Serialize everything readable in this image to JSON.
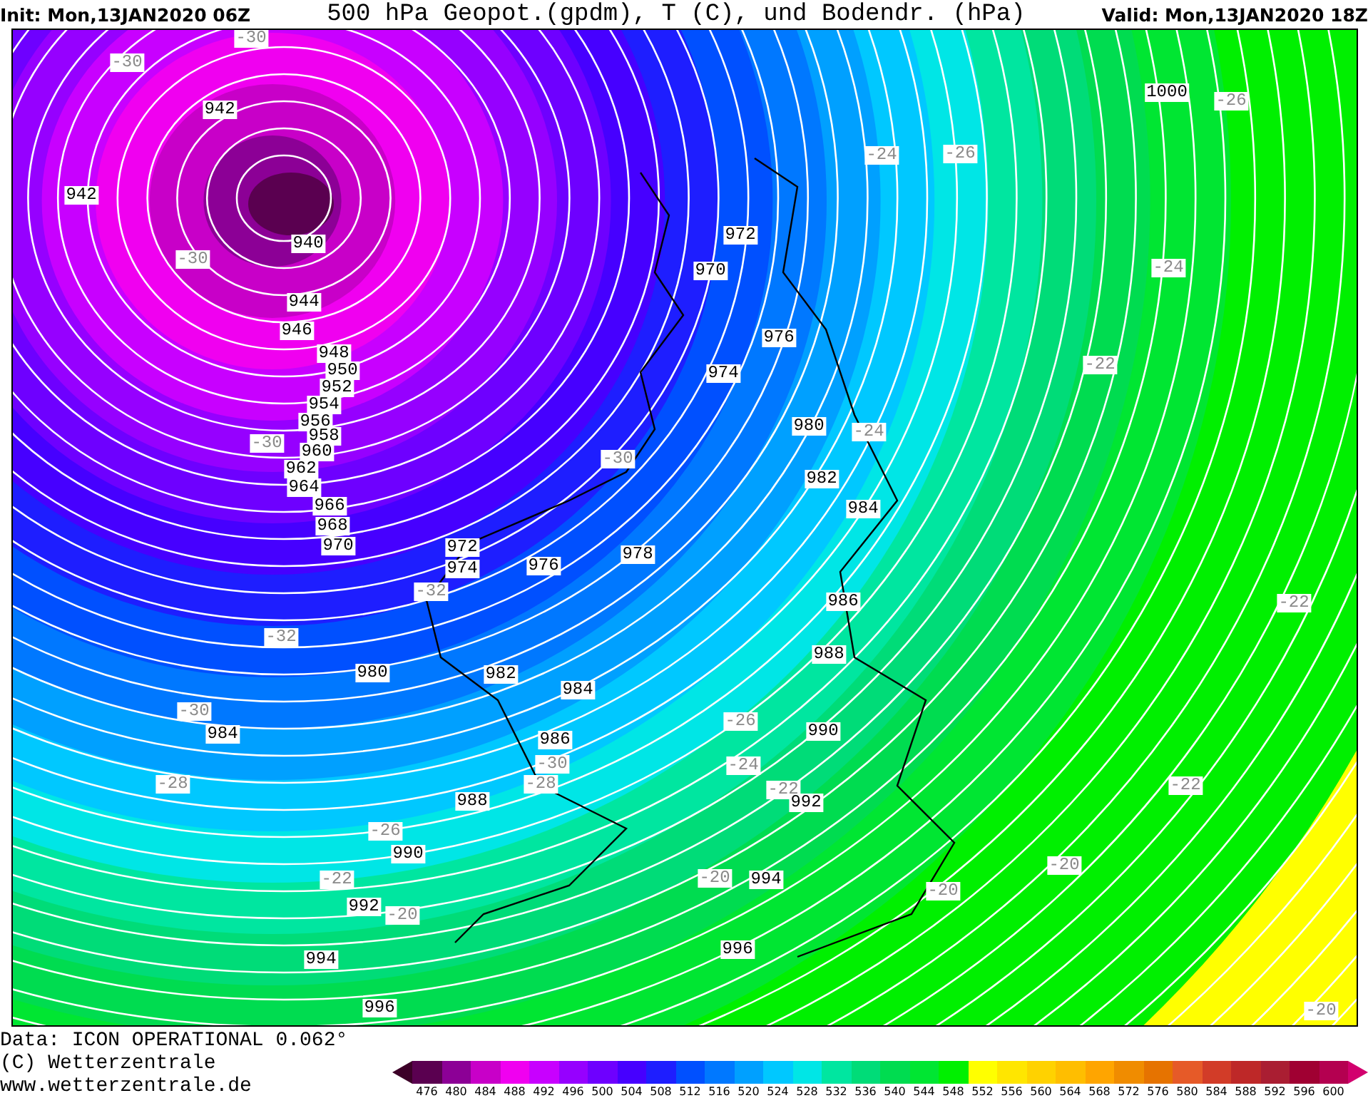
{
  "header": {
    "init": "Init: Mon,13JAN2020 06Z",
    "title": "500 hPa Geopot.(gpdm), T (C), und Bodendr. (hPa)",
    "valid": "Valid: Mon,13JAN2020 18Z"
  },
  "map": {
    "pressure_labels": [
      "942",
      "942",
      "940",
      "944",
      "946",
      "948",
      "950",
      "952",
      "954",
      "956",
      "958",
      "960",
      "962",
      "964",
      "966",
      "968",
      "970",
      "972",
      "974",
      "976",
      "978",
      "972",
      "970",
      "976",
      "974",
      "980",
      "982",
      "984",
      "986",
      "988",
      "980",
      "982",
      "984",
      "986",
      "990",
      "984",
      "988",
      "992",
      "990",
      "994",
      "992",
      "996",
      "994",
      "996",
      "1000"
    ],
    "temperature_labels": [
      "-30",
      "-30",
      "-26",
      "-24",
      "-26",
      "-30",
      "-24",
      "-22",
      "-24",
      "-30",
      "-30",
      "-32",
      "-32",
      "-22",
      "-30",
      "-26",
      "-24",
      "-30",
      "-28",
      "-28",
      "-22",
      "-22",
      "-26",
      "-22",
      "-20",
      "-20",
      "-20",
      "-20",
      "-20"
    ]
  },
  "footer": {
    "lines": [
      "Data: ICON OPERATIONAL 0.062°",
      "(C) Wetterzentrale",
      "www.wetterzentrale.de"
    ]
  },
  "legend": [
    {
      "label": "476",
      "color": "#5a0050"
    },
    {
      "label": "480",
      "color": "#8c0096"
    },
    {
      "label": "484",
      "color": "#c800c8"
    },
    {
      "label": "488",
      "color": "#f000f0"
    },
    {
      "label": "492",
      "color": "#c800ff"
    },
    {
      "label": "496",
      "color": "#9600ff"
    },
    {
      "label": "500",
      "color": "#6e00ff"
    },
    {
      "label": "504",
      "color": "#4600ff"
    },
    {
      "label": "508",
      "color": "#1e1eff"
    },
    {
      "label": "512",
      "color": "#0050ff"
    },
    {
      "label": "516",
      "color": "#0078ff"
    },
    {
      "label": "520",
      "color": "#00a0ff"
    },
    {
      "label": "524",
      "color": "#00c8ff"
    },
    {
      "label": "528",
      "color": "#00e6e6"
    },
    {
      "label": "532",
      "color": "#00e6a0"
    },
    {
      "label": "536",
      "color": "#00dc78"
    },
    {
      "label": "540",
      "color": "#00dc50"
    },
    {
      "label": "544",
      "color": "#00e632"
    },
    {
      "label": "548",
      "color": "#00f000"
    },
    {
      "label": "552",
      "color": "#ffff00"
    },
    {
      "label": "556",
      "color": "#ffe600"
    },
    {
      "label": "560",
      "color": "#ffd200"
    },
    {
      "label": "564",
      "color": "#ffbe00"
    },
    {
      "label": "568",
      "color": "#ffa500"
    },
    {
      "label": "572",
      "color": "#f08c00"
    },
    {
      "label": "576",
      "color": "#e67300"
    },
    {
      "label": "580",
      "color": "#e65a28"
    },
    {
      "label": "584",
      "color": "#d23c28"
    },
    {
      "label": "588",
      "color": "#be2828"
    },
    {
      "label": "592",
      "color": "#aa1e32"
    },
    {
      "label": "596",
      "color": "#a00032"
    },
    {
      "label": "600",
      "color": "#b40050"
    }
  ]
}
